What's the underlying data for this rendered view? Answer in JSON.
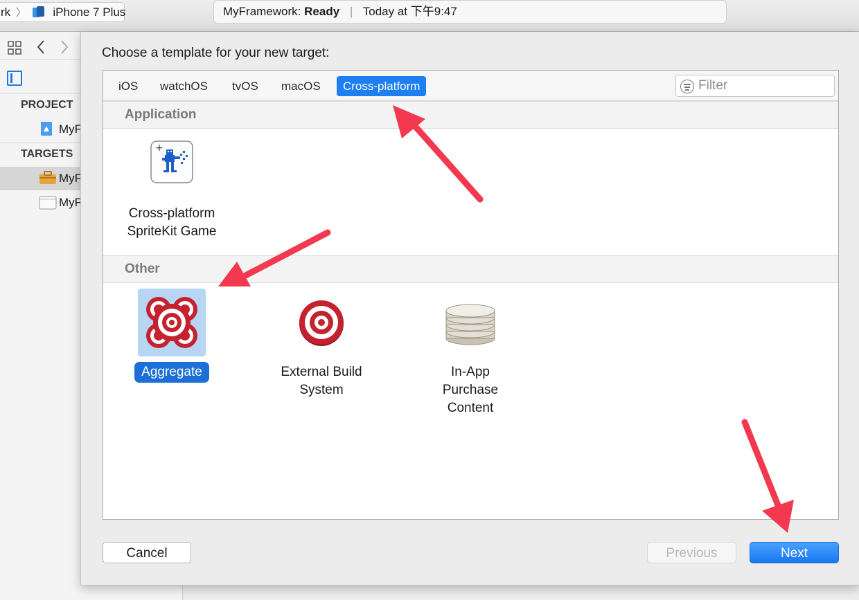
{
  "toolbar": {
    "scheme_prefix": "rk",
    "scheme_separator": "〉",
    "device": "iPhone 7 Plus",
    "activity_project": "MyFramework:",
    "activity_status": "Ready",
    "activity_divider": "|",
    "activity_time": "Today at 下午9:47"
  },
  "navigator": {
    "project_section": "PROJECT",
    "targets_section": "TARGETS",
    "project_item": "MyF",
    "target_items": [
      "MyF",
      "MyF"
    ]
  },
  "sheet": {
    "title": "Choose a template for your new target:",
    "tabs": [
      "iOS",
      "watchOS",
      "tvOS",
      "macOS",
      "Cross-platform"
    ],
    "active_tab": "Cross-platform",
    "filter_placeholder": "Filter",
    "groups": [
      {
        "name": "Application",
        "templates": [
          {
            "label": "Cross-platform\nSpriteKit Game",
            "icon": "spritekit-game-icon",
            "selected": false
          }
        ]
      },
      {
        "name": "Other",
        "templates": [
          {
            "label": "Aggregate",
            "icon": "aggregate-icon",
            "selected": true
          },
          {
            "label": "External Build\nSystem",
            "icon": "target-icon",
            "selected": false
          },
          {
            "label": "In-App Purchase\nContent",
            "icon": "coins-icon",
            "selected": false
          }
        ]
      }
    ],
    "buttons": {
      "cancel": "Cancel",
      "previous": "Previous",
      "next": "Next",
      "previous_enabled": false
    }
  },
  "colors": {
    "accent": "#1d7ff2",
    "annotation_arrow": "#f2394f"
  }
}
